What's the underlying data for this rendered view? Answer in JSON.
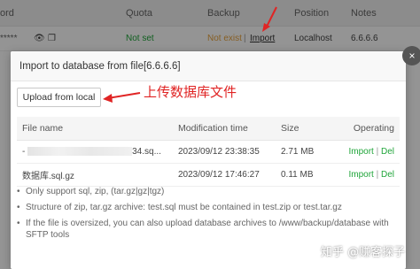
{
  "background": {
    "headers": {
      "password": "ord",
      "quota": "Quota",
      "backup": "Backup",
      "position": "Position",
      "notes": "Notes"
    },
    "row": {
      "password_mask": "*****",
      "quota": "Not set",
      "backup_status": "Not exist",
      "separator": "|",
      "import_link": "Import",
      "position": "Localhost",
      "notes": "6.6.6.6"
    }
  },
  "modal": {
    "title": "Import to database from file[6.6.6.6]",
    "close_label": "×",
    "upload_button": "Upload from local",
    "annotation": "上传数据库文件",
    "table": {
      "columns": [
        "File name",
        "Modification time",
        "Size",
        "Operating"
      ],
      "rows": [
        {
          "name_prefix": "-",
          "name_suffix": "34.sq...",
          "time": "2023/09/12 23:38:35",
          "size": "2.71 MB",
          "import": "Import",
          "sep": "|",
          "del": "Del"
        },
        {
          "name": "数据库.sql.gz",
          "time": "2023/09/12 17:46:27",
          "size": "0.11 MB",
          "import": "Import",
          "sep": "|",
          "del": "Del"
        }
      ]
    },
    "notes": [
      "Only support sql, zip, (tar.gz|gz|tgz)",
      "Structure of zip, tar.gz archive: test.sql must be contained in test.zip or test.tar.gz",
      "If the file is oversized, you can also upload database archives to /www/backup/database with SFTP tools"
    ]
  },
  "watermark": "知乎 @赚客探子",
  "colors": {
    "accent_green": "#20a53a",
    "warning_orange": "#e7a33e",
    "annotation_red": "#e02424"
  }
}
